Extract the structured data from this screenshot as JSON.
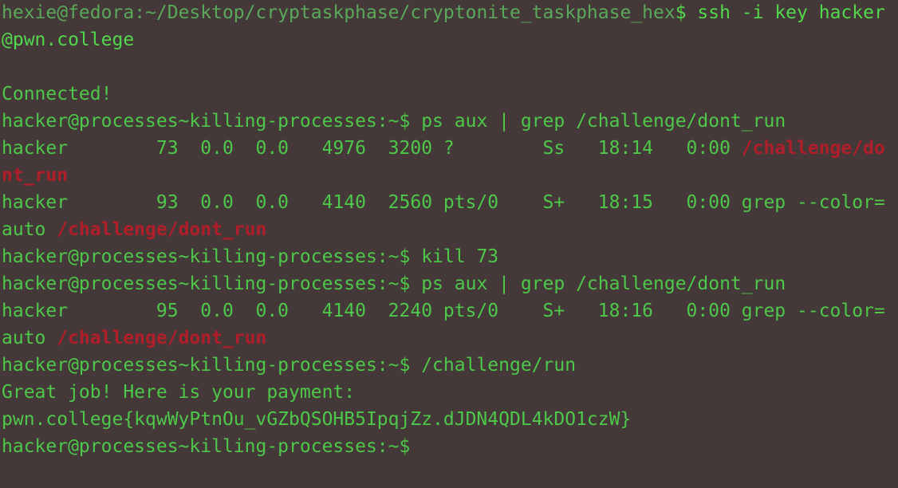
{
  "terminal": {
    "line0": {
      "host_prompt": "hexie@fedora",
      "sep": ":",
      "path": "~/Desktop/cryptaskphase/cryptonite_taskphase_hex",
      "dollar": "$ ",
      "command": "ssh -i key hacker"
    },
    "line1": "@pwn.college",
    "line2": "",
    "line3": "Connected!",
    "line4": {
      "prompt": "hacker@processes~killing-processes:~$ ",
      "command": "ps aux | grep /challenge/dont_run"
    },
    "line5": {
      "text": "hacker        73  0.0  0.0   4976  3200 ?        Ss   18:14   0:00 ",
      "match": "/challenge/do"
    },
    "line6": {
      "match": "nt_run"
    },
    "line7": {
      "text": "hacker        93  0.0  0.0   4140  2560 pts/0    S+   18:15   0:00 grep --color="
    },
    "line8": {
      "text": "auto ",
      "match": "/challenge/dont_run"
    },
    "line9": {
      "prompt": "hacker@processes~killing-processes:~$ ",
      "command": "kill 73"
    },
    "line10": {
      "prompt": "hacker@processes~killing-processes:~$ ",
      "command": "ps aux | grep /challenge/dont_run"
    },
    "line11": {
      "text": "hacker        95  0.0  0.0   4140  2240 pts/0    S+   18:16   0:00 grep --color="
    },
    "line12": {
      "text": "auto ",
      "match": "/challenge/dont_run"
    },
    "line13": {
      "prompt": "hacker@processes~killing-processes:~$ ",
      "command": "/challenge/run"
    },
    "line14": "Great job! Here is your payment:",
    "line15": "pwn.college{kqwWyPtnOu_vGZbQSOHB5IpqjZz.dJDN4QDL4kDO1czW}",
    "line16": {
      "prompt": "hacker@processes~killing-processes:~$"
    }
  },
  "colors": {
    "background": "#443838",
    "text": "#4ec84a",
    "match_highlight": "#b01e2a"
  }
}
